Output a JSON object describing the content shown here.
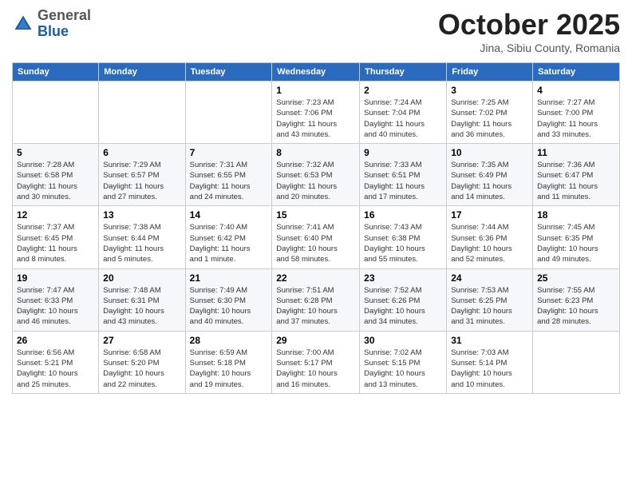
{
  "header": {
    "logo_general": "General",
    "logo_blue": "Blue",
    "month": "October 2025",
    "location": "Jina, Sibiu County, Romania"
  },
  "weekdays": [
    "Sunday",
    "Monday",
    "Tuesday",
    "Wednesday",
    "Thursday",
    "Friday",
    "Saturday"
  ],
  "weeks": [
    [
      {
        "day": "",
        "info": ""
      },
      {
        "day": "",
        "info": ""
      },
      {
        "day": "",
        "info": ""
      },
      {
        "day": "1",
        "info": "Sunrise: 7:23 AM\nSunset: 7:06 PM\nDaylight: 11 hours\nand 43 minutes."
      },
      {
        "day": "2",
        "info": "Sunrise: 7:24 AM\nSunset: 7:04 PM\nDaylight: 11 hours\nand 40 minutes."
      },
      {
        "day": "3",
        "info": "Sunrise: 7:25 AM\nSunset: 7:02 PM\nDaylight: 11 hours\nand 36 minutes."
      },
      {
        "day": "4",
        "info": "Sunrise: 7:27 AM\nSunset: 7:00 PM\nDaylight: 11 hours\nand 33 minutes."
      }
    ],
    [
      {
        "day": "5",
        "info": "Sunrise: 7:28 AM\nSunset: 6:58 PM\nDaylight: 11 hours\nand 30 minutes."
      },
      {
        "day": "6",
        "info": "Sunrise: 7:29 AM\nSunset: 6:57 PM\nDaylight: 11 hours\nand 27 minutes."
      },
      {
        "day": "7",
        "info": "Sunrise: 7:31 AM\nSunset: 6:55 PM\nDaylight: 11 hours\nand 24 minutes."
      },
      {
        "day": "8",
        "info": "Sunrise: 7:32 AM\nSunset: 6:53 PM\nDaylight: 11 hours\nand 20 minutes."
      },
      {
        "day": "9",
        "info": "Sunrise: 7:33 AM\nSunset: 6:51 PM\nDaylight: 11 hours\nand 17 minutes."
      },
      {
        "day": "10",
        "info": "Sunrise: 7:35 AM\nSunset: 6:49 PM\nDaylight: 11 hours\nand 14 minutes."
      },
      {
        "day": "11",
        "info": "Sunrise: 7:36 AM\nSunset: 6:47 PM\nDaylight: 11 hours\nand 11 minutes."
      }
    ],
    [
      {
        "day": "12",
        "info": "Sunrise: 7:37 AM\nSunset: 6:45 PM\nDaylight: 11 hours\nand 8 minutes."
      },
      {
        "day": "13",
        "info": "Sunrise: 7:38 AM\nSunset: 6:44 PM\nDaylight: 11 hours\nand 5 minutes."
      },
      {
        "day": "14",
        "info": "Sunrise: 7:40 AM\nSunset: 6:42 PM\nDaylight: 11 hours\nand 1 minute."
      },
      {
        "day": "15",
        "info": "Sunrise: 7:41 AM\nSunset: 6:40 PM\nDaylight: 10 hours\nand 58 minutes."
      },
      {
        "day": "16",
        "info": "Sunrise: 7:43 AM\nSunset: 6:38 PM\nDaylight: 10 hours\nand 55 minutes."
      },
      {
        "day": "17",
        "info": "Sunrise: 7:44 AM\nSunset: 6:36 PM\nDaylight: 10 hours\nand 52 minutes."
      },
      {
        "day": "18",
        "info": "Sunrise: 7:45 AM\nSunset: 6:35 PM\nDaylight: 10 hours\nand 49 minutes."
      }
    ],
    [
      {
        "day": "19",
        "info": "Sunrise: 7:47 AM\nSunset: 6:33 PM\nDaylight: 10 hours\nand 46 minutes."
      },
      {
        "day": "20",
        "info": "Sunrise: 7:48 AM\nSunset: 6:31 PM\nDaylight: 10 hours\nand 43 minutes."
      },
      {
        "day": "21",
        "info": "Sunrise: 7:49 AM\nSunset: 6:30 PM\nDaylight: 10 hours\nand 40 minutes."
      },
      {
        "day": "22",
        "info": "Sunrise: 7:51 AM\nSunset: 6:28 PM\nDaylight: 10 hours\nand 37 minutes."
      },
      {
        "day": "23",
        "info": "Sunrise: 7:52 AM\nSunset: 6:26 PM\nDaylight: 10 hours\nand 34 minutes."
      },
      {
        "day": "24",
        "info": "Sunrise: 7:53 AM\nSunset: 6:25 PM\nDaylight: 10 hours\nand 31 minutes."
      },
      {
        "day": "25",
        "info": "Sunrise: 7:55 AM\nSunset: 6:23 PM\nDaylight: 10 hours\nand 28 minutes."
      }
    ],
    [
      {
        "day": "26",
        "info": "Sunrise: 6:56 AM\nSunset: 5:21 PM\nDaylight: 10 hours\nand 25 minutes."
      },
      {
        "day": "27",
        "info": "Sunrise: 6:58 AM\nSunset: 5:20 PM\nDaylight: 10 hours\nand 22 minutes."
      },
      {
        "day": "28",
        "info": "Sunrise: 6:59 AM\nSunset: 5:18 PM\nDaylight: 10 hours\nand 19 minutes."
      },
      {
        "day": "29",
        "info": "Sunrise: 7:00 AM\nSunset: 5:17 PM\nDaylight: 10 hours\nand 16 minutes."
      },
      {
        "day": "30",
        "info": "Sunrise: 7:02 AM\nSunset: 5:15 PM\nDaylight: 10 hours\nand 13 minutes."
      },
      {
        "day": "31",
        "info": "Sunrise: 7:03 AM\nSunset: 5:14 PM\nDaylight: 10 hours\nand 10 minutes."
      },
      {
        "day": "",
        "info": ""
      }
    ]
  ]
}
